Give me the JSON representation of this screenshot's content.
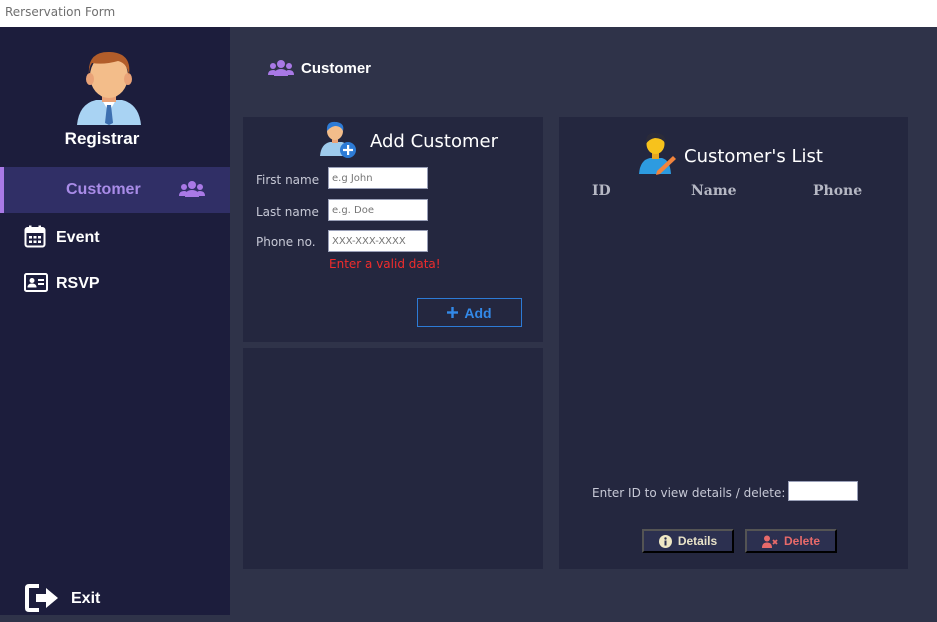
{
  "window": {
    "title": "Rerservation Form"
  },
  "sidebar": {
    "registrar_name": "Registrar",
    "items": [
      {
        "label": "Customer",
        "icon": "users-icon",
        "active": true
      },
      {
        "label": "Event",
        "icon": "calendar-icon",
        "active": false
      },
      {
        "label": "RSVP",
        "icon": "id-card-icon",
        "active": false
      }
    ],
    "exit_label": "Exit"
  },
  "header": {
    "title": "Customer",
    "icon": "users-icon"
  },
  "add_customer": {
    "title": "Add Customer",
    "fields": [
      {
        "label": "First name",
        "placeholder": "e.g John"
      },
      {
        "label": "Last name",
        "placeholder": "e.g. Doe"
      },
      {
        "label": "Phone no.",
        "placeholder": "XXX-XXX-XXXX"
      }
    ],
    "error": "Enter a valid data!",
    "add_button": "Add"
  },
  "customer_list": {
    "title": "Customer's List",
    "columns": [
      "ID",
      "Name",
      "Phone"
    ],
    "id_prompt": "Enter ID to view details / delete:",
    "details_button": "Details",
    "delete_button": "Delete"
  },
  "colors": {
    "accent": "#a979e6",
    "error": "#f02c2c",
    "add_button": "#3389e8",
    "details": "#e8e2c8",
    "delete": "#e86a6a"
  }
}
